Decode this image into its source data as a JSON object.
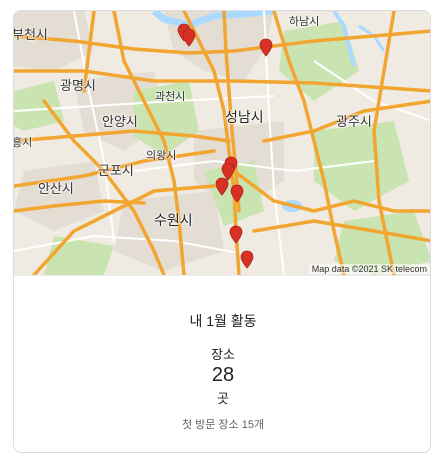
{
  "map": {
    "attribution": "Map data ©2021 SK telecom",
    "labels": {
      "bucheon": "부천시",
      "hanam": "하남시",
      "gwangmyeong": "광명시",
      "gwacheon": "과천시",
      "anyang": "안양시",
      "seongnam": "성남시",
      "gwangju": "광주시",
      "siheung": "흥시",
      "uiwang": "의왕시",
      "gunpo": "군포시",
      "ansan": "안산시",
      "suwon": "수원시"
    },
    "pin_count": 8,
    "colors": {
      "pin": "#d93025",
      "road": "#f2a530",
      "water": "#aadaff",
      "green": "#c9e4b0",
      "urban": "#e3ddd3"
    }
  },
  "stats": {
    "title": "내 1월 활동",
    "metric_label": "장소",
    "metric_value": "28",
    "metric_unit": "곳",
    "first_visit": "첫 방문 장소 15개"
  }
}
